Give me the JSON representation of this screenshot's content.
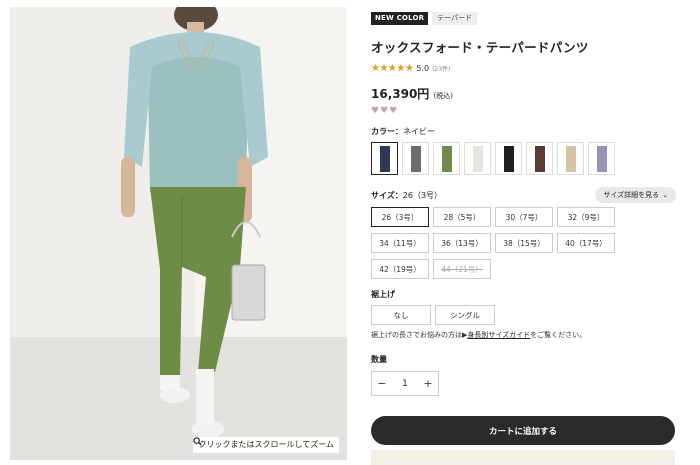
{
  "product_image": {
    "zoom_hint": "クリックまたはスクロールしてズーム",
    "zoom_icon": "magnifier-icon"
  },
  "badges": {
    "new": "NEW COLOR",
    "category": "テーパード"
  },
  "product": {
    "title": "オックスフォード・テーパードパンツ",
    "stars": "★★★★★",
    "rating": "5.0",
    "review_count": "(23件)",
    "price": "16,390円",
    "tax_note": "(税込)",
    "hearts": "♥♥♥"
  },
  "color": {
    "label": "カラー：",
    "selected": "ネイビー",
    "swatches": [
      {
        "name": "navy",
        "hex": "#2e3a55",
        "selected": true
      },
      {
        "name": "gray",
        "hex": "#6d6d6d"
      },
      {
        "name": "green",
        "hex": "#6f8a4d"
      },
      {
        "name": "white",
        "hex": "#e6e4df"
      },
      {
        "name": "black",
        "hex": "#1f1f1f"
      },
      {
        "name": "brown",
        "hex": "#5a3d30"
      },
      {
        "name": "beige",
        "hex": "#d3c4a3"
      },
      {
        "name": "lavender",
        "hex": "#9b93b6"
      }
    ]
  },
  "size": {
    "label": "サイズ：",
    "selected": "26（3号）",
    "guide_button": "サイズ詳細を見る",
    "guide_icon": "chevron-down-icon",
    "options": [
      {
        "label": "26（3号）",
        "state": "selected"
      },
      {
        "label": "28（5号）",
        "state": "available"
      },
      {
        "label": "30（7号）",
        "state": "available"
      },
      {
        "label": "32（9号）",
        "state": "available"
      },
      {
        "label": "34（11号）",
        "state": "available"
      },
      {
        "label": "36（13号）",
        "state": "available"
      },
      {
        "label": "38（15号）",
        "state": "available"
      },
      {
        "label": "40（17号）",
        "state": "available"
      },
      {
        "label": "42（19号）",
        "state": "available"
      },
      {
        "label": "44（21号）",
        "state": "disabled"
      }
    ]
  },
  "hem": {
    "label": "裾上げ",
    "options": [
      "なし",
      "シングル"
    ],
    "note_prefix": "裾上げの長さでお悩みの方は▶",
    "note_link": "身長別サイズガイド",
    "note_suffix": "をご覧ください。"
  },
  "quantity": {
    "label": "数量",
    "value": "1",
    "minus": "−",
    "plus": "+"
  },
  "cart": {
    "label": "カートに追加する"
  }
}
